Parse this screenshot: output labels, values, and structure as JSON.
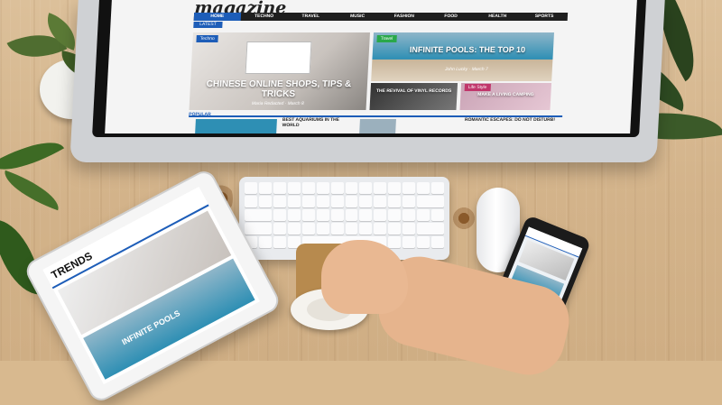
{
  "screen": {
    "logo": "magazine",
    "nav": [
      "HOME",
      "TECHNO",
      "TRAVEL",
      "MUSIC",
      "FASHION",
      "FOOD",
      "HEALTH",
      "SPORTS"
    ],
    "latest_label": "LATEST",
    "cards": {
      "main": {
        "tag": "Techno",
        "title": "CHINESE ONLINE SHOPS, TIPS & TRICKS",
        "sub": "Maria Redacted · March 8"
      },
      "pools": {
        "tag": "Travel",
        "title": "INFINITE POOLS: THE TOP 10",
        "sub": "John Lucky · March 7"
      },
      "vinyl": {
        "title": "THE REVIVAL OF VINYL RECORDS"
      },
      "living": {
        "tag": "Life Style",
        "title": "MAKE A LIVING CAMPING"
      }
    },
    "popular_label": "POPULAR",
    "popular": [
      {
        "title": "BEST AQUARIUMS IN THE WORLD"
      },
      {
        "title": "ROMANTIC ESCAPES: DO NOT DISTURB!"
      }
    ]
  },
  "tablet": {
    "logo": "TRENDS",
    "headline": "INFINITE POOLS"
  }
}
